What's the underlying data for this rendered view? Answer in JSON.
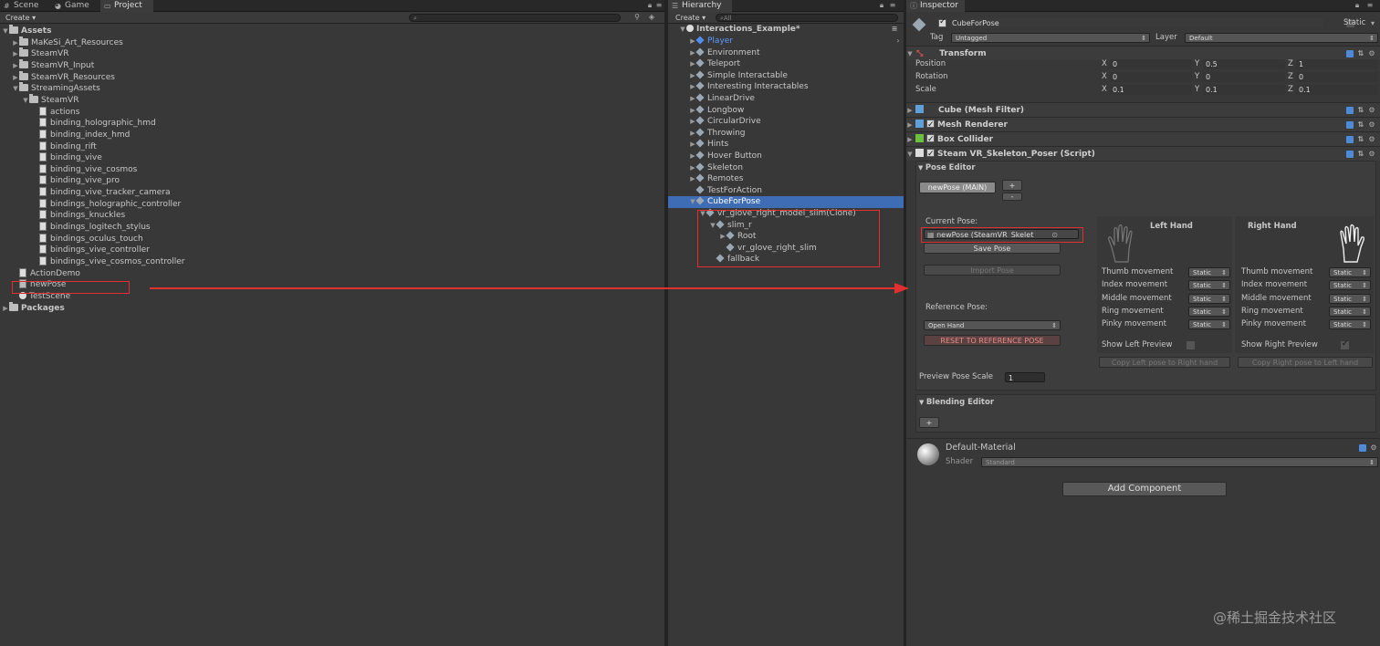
{
  "project_panel": {
    "tabs": [
      {
        "label": "Scene",
        "icon": "grid-icon"
      },
      {
        "label": "Game",
        "icon": "pacman-icon"
      },
      {
        "label": "Project",
        "icon": "folder-icon"
      }
    ],
    "create_label": "Create",
    "tree": [
      {
        "label": "Assets",
        "depth": 0,
        "icon": "folder",
        "expanded": true,
        "bold": true
      },
      {
        "label": "MaKeSi_Art_Resources",
        "depth": 1,
        "icon": "folder",
        "expanded": false
      },
      {
        "label": "SteamVR",
        "depth": 1,
        "icon": "folder",
        "expanded": false
      },
      {
        "label": "SteamVR_Input",
        "depth": 1,
        "icon": "folder",
        "expanded": false
      },
      {
        "label": "SteamVR_Resources",
        "depth": 1,
        "icon": "folder",
        "expanded": false
      },
      {
        "label": "StreamingAssets",
        "depth": 1,
        "icon": "folder",
        "expanded": true
      },
      {
        "label": "SteamVR",
        "depth": 2,
        "icon": "folder",
        "expanded": true
      },
      {
        "label": "actions",
        "depth": 3,
        "icon": "doc"
      },
      {
        "label": "binding_holographic_hmd",
        "depth": 3,
        "icon": "doc"
      },
      {
        "label": "binding_index_hmd",
        "depth": 3,
        "icon": "doc"
      },
      {
        "label": "binding_rift",
        "depth": 3,
        "icon": "doc"
      },
      {
        "label": "binding_vive",
        "depth": 3,
        "icon": "doc"
      },
      {
        "label": "binding_vive_cosmos",
        "depth": 3,
        "icon": "doc"
      },
      {
        "label": "binding_vive_pro",
        "depth": 3,
        "icon": "doc"
      },
      {
        "label": "binding_vive_tracker_camera",
        "depth": 3,
        "icon": "doc"
      },
      {
        "label": "bindings_holographic_controller",
        "depth": 3,
        "icon": "doc"
      },
      {
        "label": "bindings_knuckles",
        "depth": 3,
        "icon": "doc"
      },
      {
        "label": "bindings_logitech_stylus",
        "depth": 3,
        "icon": "doc"
      },
      {
        "label": "bindings_oculus_touch",
        "depth": 3,
        "icon": "doc"
      },
      {
        "label": "bindings_vive_controller",
        "depth": 3,
        "icon": "doc"
      },
      {
        "label": "bindings_vive_cosmos_controller",
        "depth": 3,
        "icon": "doc"
      },
      {
        "label": "ActionDemo",
        "depth": 1,
        "icon": "doc"
      },
      {
        "label": "newPose",
        "depth": 1,
        "icon": "asset"
      },
      {
        "label": "TestScene",
        "depth": 1,
        "icon": "unity"
      },
      {
        "label": "Packages",
        "depth": 0,
        "icon": "folder",
        "expanded": false,
        "bold": true
      }
    ]
  },
  "hierarchy_panel": {
    "tab": "Hierarchy",
    "create_label": "Create",
    "search_placeholder": "All",
    "scene_name": "Interactions_Example*",
    "items": [
      {
        "label": "Player",
        "depth": 1,
        "has_children": true,
        "blue": true
      },
      {
        "label": "Environment",
        "depth": 1,
        "has_children": true
      },
      {
        "label": "Teleport",
        "depth": 1,
        "has_children": true
      },
      {
        "label": "Simple Interactable",
        "depth": 1,
        "has_children": true
      },
      {
        "label": "Interesting Interactables",
        "depth": 1,
        "has_children": true
      },
      {
        "label": "LinearDrive",
        "depth": 1,
        "has_children": true
      },
      {
        "label": "Longbow",
        "depth": 1,
        "has_children": true
      },
      {
        "label": "CircularDrive",
        "depth": 1,
        "has_children": true
      },
      {
        "label": "Throwing",
        "depth": 1,
        "has_children": true
      },
      {
        "label": "Hints",
        "depth": 1,
        "has_children": true
      },
      {
        "label": "Hover Button",
        "depth": 1,
        "has_children": true
      },
      {
        "label": "Skeleton",
        "depth": 1,
        "has_children": true
      },
      {
        "label": "Remotes",
        "depth": 1,
        "has_children": true
      },
      {
        "label": "TestForAction",
        "depth": 1,
        "has_children": false
      },
      {
        "label": "CubeForPose",
        "depth": 1,
        "has_children": true,
        "expanded": true,
        "selected": true
      },
      {
        "label": "vr_glove_right_model_slim(Clone)",
        "depth": 2,
        "has_children": true,
        "expanded": true
      },
      {
        "label": "slim_r",
        "depth": 3,
        "has_children": true,
        "expanded": true
      },
      {
        "label": "Root",
        "depth": 4,
        "has_children": true
      },
      {
        "label": "vr_glove_right_slim",
        "depth": 4,
        "has_children": false
      },
      {
        "label": "fallback",
        "depth": 3,
        "has_children": false
      }
    ]
  },
  "inspector": {
    "tab": "Inspector",
    "object_name": "CubeForPose",
    "static_label": "Static",
    "tag_label": "Tag",
    "tag_value": "Untagged",
    "layer_label": "Layer",
    "layer_value": "Default",
    "transform": {
      "title": "Transform",
      "rows": [
        {
          "label": "Position",
          "x": "0",
          "y": "0.5",
          "z": "1"
        },
        {
          "label": "Rotation",
          "x": "0",
          "y": "0",
          "z": "0"
        },
        {
          "label": "Scale",
          "x": "0.1",
          "y": "0.1",
          "z": "0.1"
        }
      ],
      "axis_x": "X",
      "axis_y": "Y",
      "axis_z": "Z"
    },
    "components": [
      {
        "title": "Cube (Mesh Filter)",
        "checkbox": false
      },
      {
        "title": "Mesh Renderer",
        "checkbox": true
      },
      {
        "title": "Box Collider",
        "checkbox": true
      },
      {
        "title": "Steam VR_Skeleton_Poser (Script)",
        "checkbox": true
      }
    ],
    "pose_editor": {
      "title": "Pose Editor",
      "pose_tab": "newPose (MAIN)",
      "plus": "+",
      "minus": "-",
      "current_pose_label": "Current Pose:",
      "current_pose_value": "newPose (SteamVR_Skelet",
      "save_pose": "Save Pose",
      "import_pose": "Import Pose",
      "reference_pose_label": "Reference Pose:",
      "reference_pose_value": "Open Hand",
      "reset_button": "RESET TO REFERENCE POSE",
      "left_hand_title": "Left Hand",
      "right_hand_title": "Right Hand",
      "movements": [
        {
          "label": "Thumb movement",
          "left": "Static",
          "right": "Static"
        },
        {
          "label": "Index movement",
          "left": "Static",
          "right": "Static"
        },
        {
          "label": "Middle movement",
          "left": "Static",
          "right": "Static"
        },
        {
          "label": "Ring movement",
          "left": "Static",
          "right": "Static"
        },
        {
          "label": "Pinky movement",
          "left": "Static",
          "right": "Static"
        }
      ],
      "show_left_preview": "Show Left Preview",
      "show_right_preview": "Show Right Preview",
      "copy_left": "Copy Left pose to Right hand",
      "copy_right": "Copy Right pose to Left hand",
      "preview_scale_label": "Preview Pose Scale",
      "preview_scale_value": "1"
    },
    "blending_editor": {
      "title": "Blending Editor",
      "plus": "+"
    },
    "material": {
      "name": "Default-Material",
      "shader_label": "Shader",
      "shader_value": "Standard"
    },
    "add_component": "Add Component"
  },
  "watermark": "@稀土掘金技术社区",
  "colors": {
    "selection": "#3e6db5",
    "highlight_box": "#e03030",
    "panel_bg": "#383838"
  }
}
